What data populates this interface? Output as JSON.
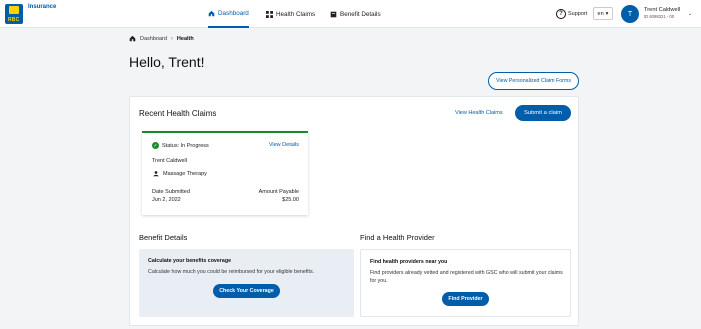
{
  "header": {
    "brand": "Insurance",
    "logo_text": "RBC",
    "nav": [
      {
        "label": "Dashboard",
        "icon": "home-icon"
      },
      {
        "label": "Health Claims",
        "icon": "grid-icon"
      },
      {
        "label": "Benefit Details",
        "icon": "book-icon"
      }
    ],
    "support_label": "Support",
    "language": "en",
    "user": {
      "initial": "T",
      "name": "Trent Caldwell",
      "id": "ID 6098321 - 00"
    }
  },
  "breadcrumb": {
    "home": "Dashboard",
    "current": "Health"
  },
  "greeting": "Hello, Trent!",
  "claim_forms_button": "View Personalized Claim Forms",
  "recent_claims": {
    "title": "Recent Health Claims",
    "view_link": "View Health Claims",
    "submit_button": "Submit a claim",
    "claim": {
      "status": "Status: In Progress",
      "view_details": "View Details",
      "name": "Trent Caldwell",
      "service": "Massage Therapy",
      "date_label": "Date Submitted",
      "date_value": "Jun 2, 2022",
      "amount_label": "Amount Payable",
      "amount_value": "$25.00"
    }
  },
  "benefit_details": {
    "title": "Benefit Details",
    "box_title": "Calculate your benefits coverage",
    "box_text": "Calculate how much you could be reimbursed for your eligible benefits.",
    "button": "Check Your Coverage"
  },
  "provider": {
    "title": "Find a Health Provider",
    "box_title": "Find health providers near you",
    "box_text": "Find providers already vetted and registered with GSC who will submit your claims for you.",
    "button": "Find Provider"
  },
  "colors": {
    "primary": "#005daa",
    "status_green": "#168c2e",
    "logo_yellow": "#ffd200"
  }
}
